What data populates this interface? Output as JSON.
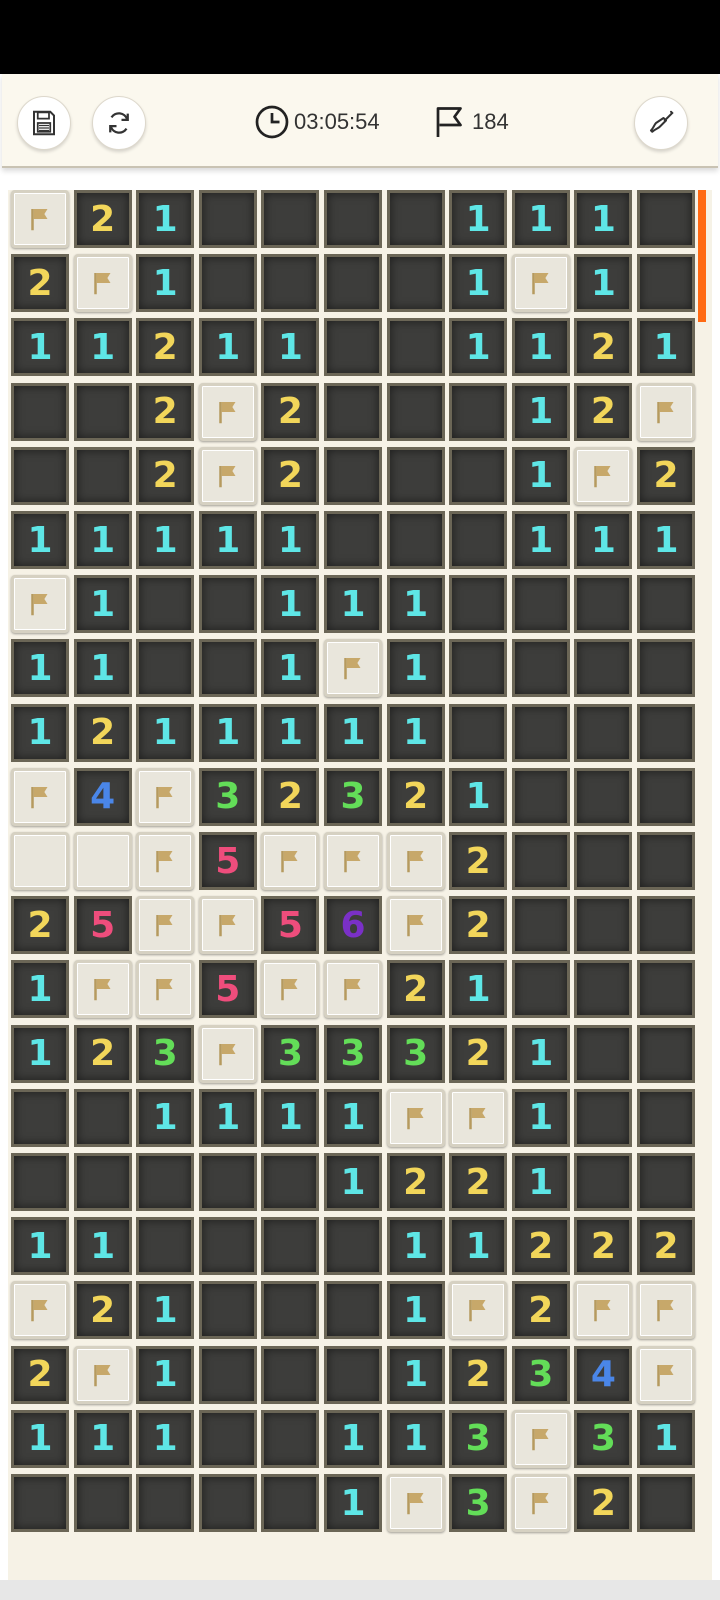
{
  "header": {
    "timer": "03:05:54",
    "flags_remaining": "184",
    "save_icon": "save-disk-icon",
    "restart_icon": "restart-arrows-icon",
    "hint_icon": "shovel-icon"
  },
  "colors": {
    "1": "#5ee6e6",
    "2": "#f2d65a",
    "3": "#63dd58",
    "4": "#4a86e8",
    "5": "#ee4d7c",
    "6": "#7a30c7",
    "flag": "#c7a86a",
    "scrollbar": "#ff6a13"
  },
  "board": {
    "columns": 11,
    "legend": "F = flagged, C = covered, . = empty revealed, digits = adjacent mine counts",
    "rows": [
      "F21....111.",
      "2F1....1F1.",
      "11211..1121",
      "..2F2...12F",
      "..2F2...1F2",
      "11111...111",
      "F1..111....",
      "11..1F1....",
      "1211111....",
      "F4F32321...",
      "CCF5FFF2...",
      "25FF56F2...",
      "1FF5FF21...",
      "123F33321..",
      "..1111FF1..",
      ".....1221..",
      "11....11222",
      "F21...1F2FF",
      "2F1...1234F",
      "111..113F31",
      ".....1F3F2."
    ]
  }
}
